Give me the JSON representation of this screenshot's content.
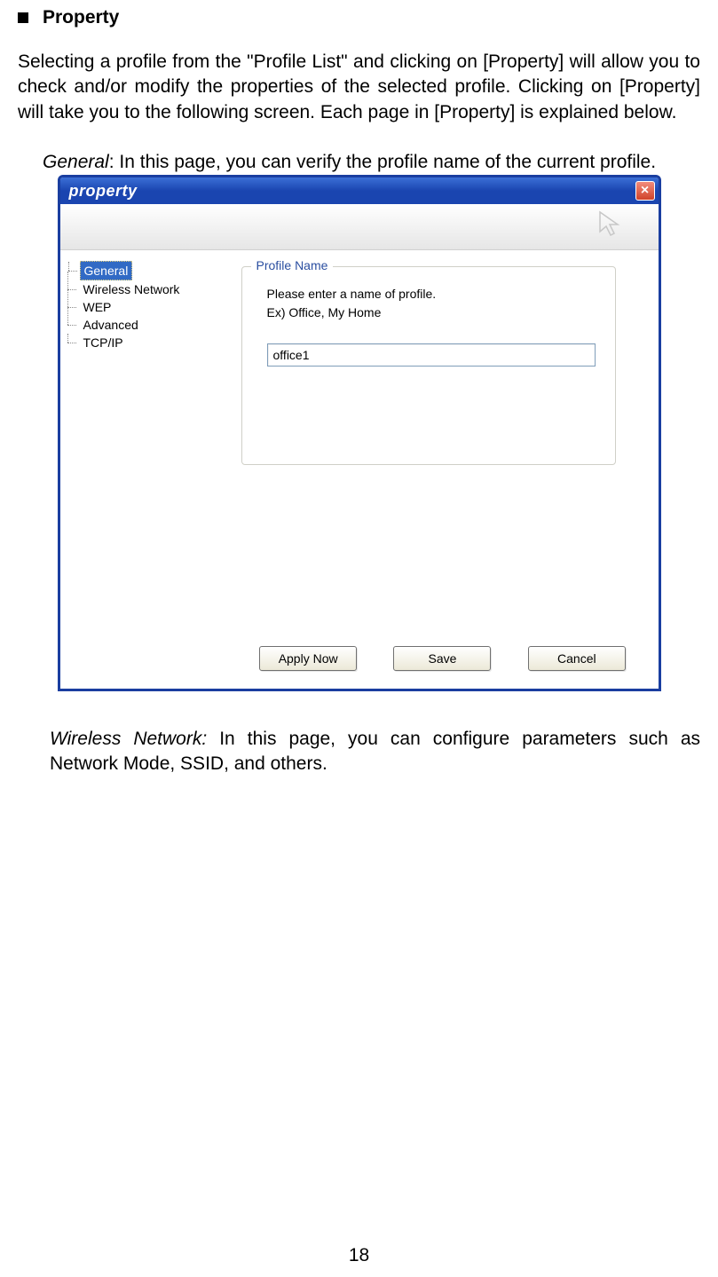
{
  "heading": {
    "title": "Property"
  },
  "intro_paragraph": "Selecting a profile from the \"Profile List\" and clicking on [Property] will allow you to check and/or modify the properties of the selected profile. Clicking on [Property] will take you to the following screen. Each page in [Property] is explained below.",
  "general_line": {
    "label": "General",
    "rest": ": In this page, you can verify the profile name of the current profile."
  },
  "window": {
    "title": "property",
    "close": "×",
    "tree": {
      "items": [
        "General",
        "Wireless Network",
        "WEP",
        "Advanced",
        "TCP/IP"
      ],
      "selected_index": 0
    },
    "panel": {
      "legend": "Profile Name",
      "desc_line1": "Please enter a name of profile.",
      "desc_line2": "Ex) Office, My Home",
      "input_value": "office1"
    },
    "buttons": {
      "apply": "Apply Now",
      "save": "Save",
      "cancel": "Cancel"
    }
  },
  "wireless_paragraph": {
    "label": "Wireless Network:",
    "rest": " In this page, you can configure parameters such as Network Mode, SSID, and others."
  },
  "page_number": "18"
}
